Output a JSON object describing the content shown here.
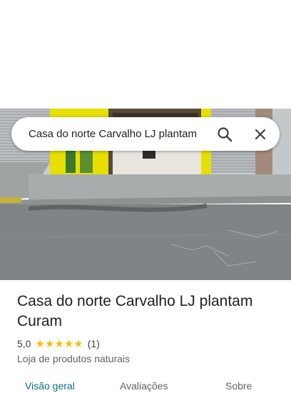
{
  "search": {
    "query": "Casa do norte Carvalho LJ plantam"
  },
  "place": {
    "name": "Casa do norte Carvalho LJ plantam Curam",
    "rating": "5,0",
    "stars": "★★★★★",
    "review_count": "(1)",
    "category": "Loja de produtos naturais"
  },
  "tabs": [
    {
      "label": "Visão geral",
      "active": true
    },
    {
      "label": "Avaliações",
      "active": false
    },
    {
      "label": "Sobre",
      "active": false
    }
  ],
  "colors": {
    "star": "#fbbc04",
    "active_tab": "#0b6f86",
    "storefront_yellow": "#e8e000"
  },
  "icons": [
    "search-icon",
    "close-icon"
  ]
}
